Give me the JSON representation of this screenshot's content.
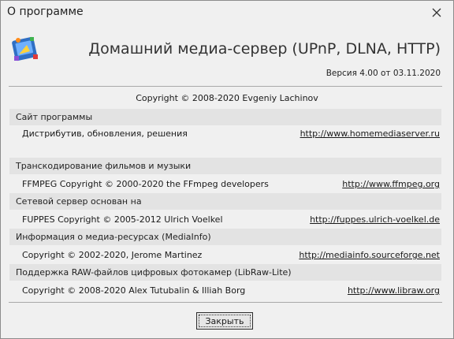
{
  "window": {
    "title": "О программе"
  },
  "header": {
    "app_title": "Домашний медиа-сервер (UPnP, DLNA, HTTP)",
    "version": "Версия 4.00 от 03.11.2020",
    "copyright": "Copyright © 2008-2020 Evgeniy Lachinov"
  },
  "sections": [
    {
      "heading": "Сайт программы",
      "desc": "Дистрибутив, обновления, решения",
      "link": "http://www.homemediaserver.ru"
    },
    {
      "heading": "Транскодирование фильмов и музыки",
      "desc": "FFMPEG Copyright © 2000-2020 the FFmpeg developers",
      "link": "http://www.ffmpeg.org"
    },
    {
      "heading": "Сетевой сервер основан на",
      "desc": "FUPPES Copyright © 2005-2012 Ulrich Voelkel",
      "link": "http://fuppes.ulrich-voelkel.de"
    },
    {
      "heading": "Информация о медиа-ресурсах (MediaInfo)",
      "desc": "Copyright © 2002-2020, Jerome Martinez",
      "link": "http://mediainfo.sourceforge.net"
    },
    {
      "heading": "Поддержка RAW-файлов цифровых фотокамер (LibRaw-Lite)",
      "desc": "Copyright © 2008-2020 Alex Tutubalin & Illiah Borg",
      "link": "http://www.libraw.org"
    }
  ],
  "footer": {
    "close_label": "Закрыть"
  }
}
